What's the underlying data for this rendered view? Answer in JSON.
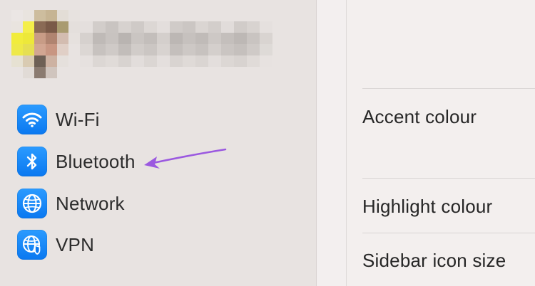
{
  "sidebar": {
    "items": [
      {
        "label": "Wi-Fi",
        "icon": "wifi-icon"
      },
      {
        "label": "Bluetooth",
        "icon": "bluetooth-icon"
      },
      {
        "label": "Network",
        "icon": "globe-icon"
      },
      {
        "label": "VPN",
        "icon": "vpn-globe-shield-icon"
      }
    ]
  },
  "content": {
    "rows": [
      {
        "label": "Accent colour"
      },
      {
        "label": "Highlight colour"
      },
      {
        "label": "Sidebar icon size"
      }
    ]
  },
  "colors": {
    "icon_blue": "#0a84ff",
    "annotation_arrow": "#9b59e0"
  }
}
